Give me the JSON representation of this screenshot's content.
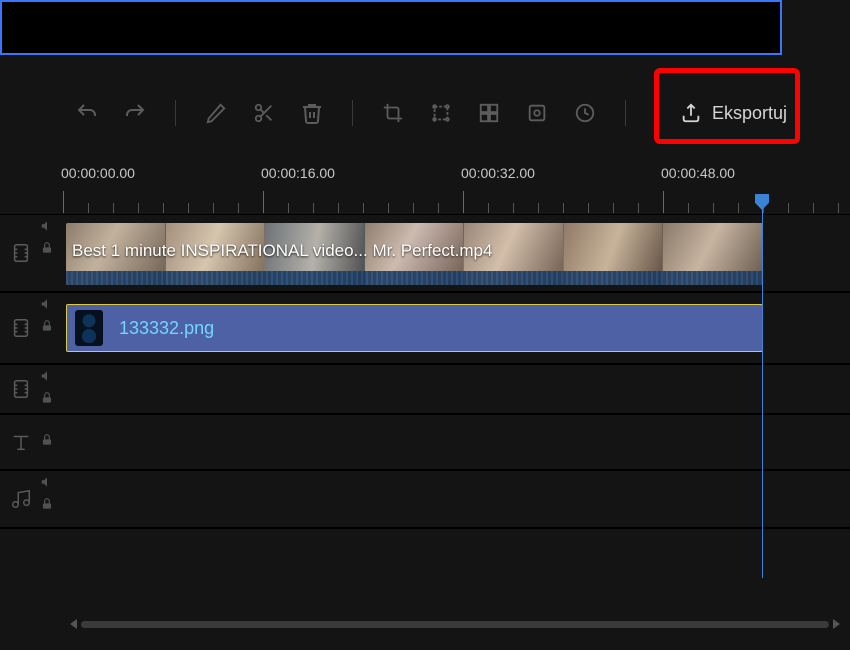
{
  "toolbar": {
    "export_label": "Eksportuj"
  },
  "ruler": {
    "labels": [
      "00:00:00.00",
      "00:00:16.00",
      "00:00:32.00",
      "00:00:48.00"
    ]
  },
  "clips": {
    "video_name": "Best 1 minute INSPIRATIONAL video... Mr. Perfect.mp4",
    "image_name": "133332.png"
  }
}
